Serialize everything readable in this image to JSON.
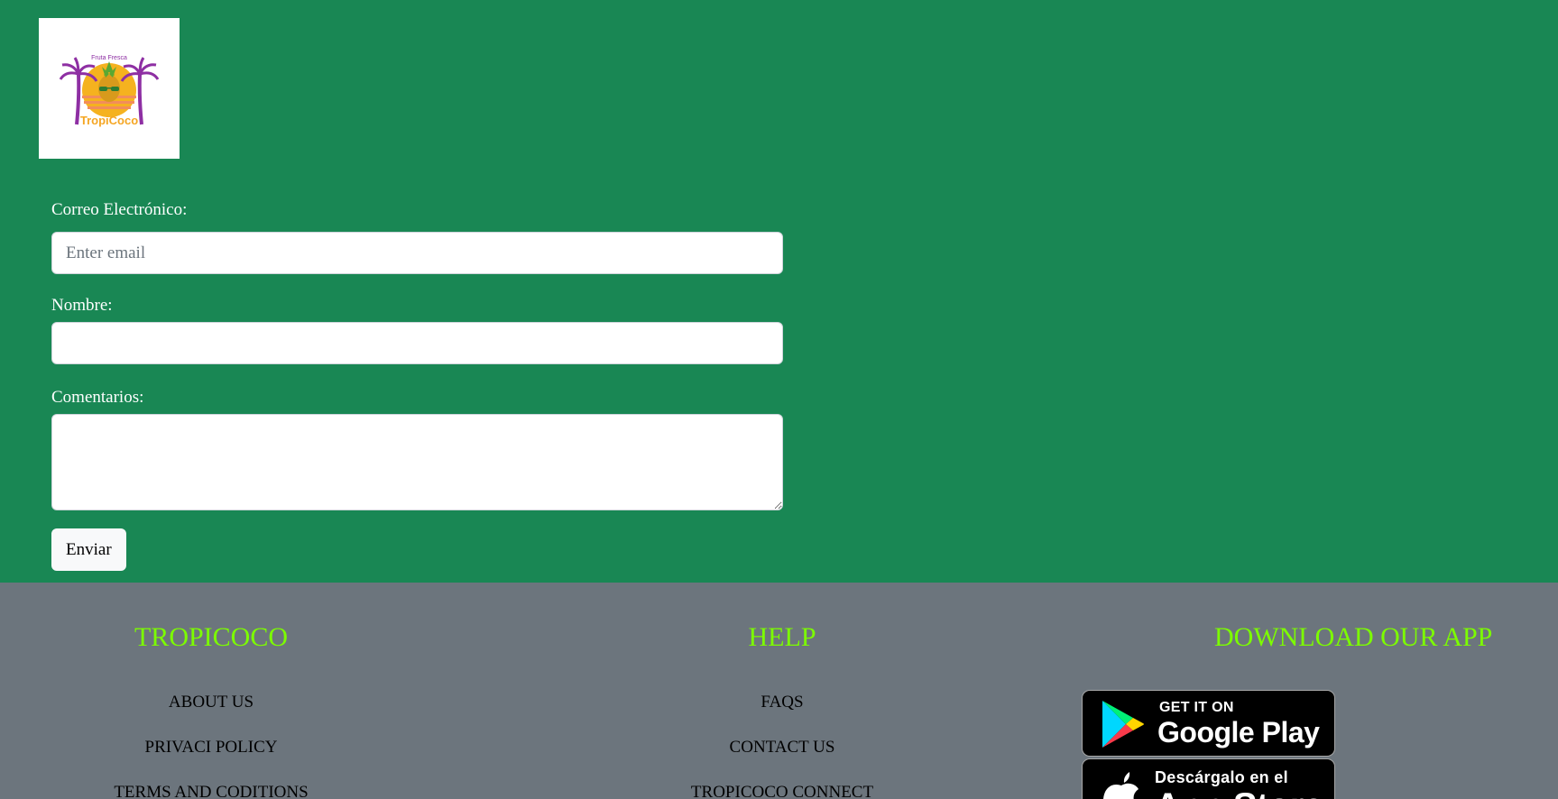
{
  "logo": {
    "top_text": "Fruta Fresca",
    "brand_text": "TropiCoco"
  },
  "form": {
    "email_label": "Correo Electrónico:",
    "email_placeholder": "Enter email",
    "email_value": "",
    "name_label": "Nombre:",
    "name_value": "",
    "comments_label": "Comentarios:",
    "comments_value": "",
    "submit_label": "Enviar"
  },
  "footer": {
    "col1": {
      "title": "TROPICOCO",
      "links": [
        "ABOUT US",
        "PRIVACI POLICY",
        "TERMS AND CODITIONS"
      ]
    },
    "col2": {
      "title": "HELP",
      "links": [
        "FAQS",
        "CONTACT US",
        "TROPICOCO CONNECT"
      ]
    },
    "col3": {
      "title": "DOWNLOAD OUR APP",
      "google_play": {
        "small": "GET IT ON",
        "big": "Google Play",
        "icon": "google-play-icon"
      },
      "app_store": {
        "small": "Descárgalo en el",
        "big": "App Store",
        "icon": "apple-icon"
      }
    }
  },
  "colors": {
    "page_background": "#198754",
    "footer_background": "#6c757d",
    "footer_heading": "#7cfc00",
    "logo_palm": "#8e2fa3",
    "logo_sun": "#f5a623"
  }
}
